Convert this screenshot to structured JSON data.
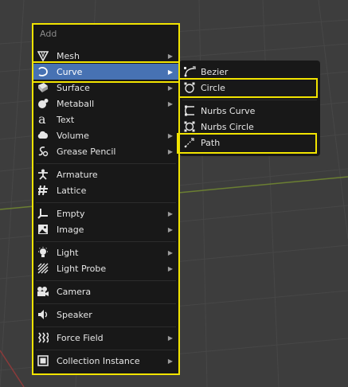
{
  "menu": {
    "title": "Add",
    "items": [
      {
        "label": "Mesh",
        "icon": "mesh-cone-icon",
        "arrow": "▶"
      },
      {
        "label": "Curve",
        "icon": "curve-icon",
        "arrow": "▶"
      },
      {
        "label": "Surface",
        "icon": "surface-icon",
        "arrow": "▶"
      },
      {
        "label": "Metaball",
        "icon": "metaball-icon",
        "arrow": "▶"
      },
      {
        "label": "Text",
        "icon": "text-icon"
      },
      {
        "label": "Volume",
        "icon": "volume-icon",
        "arrow": "▶"
      },
      {
        "label": "Grease Pencil",
        "icon": "grease-pencil-icon",
        "arrow": "▶"
      },
      {
        "label": "Armature",
        "icon": "armature-icon"
      },
      {
        "label": "Lattice",
        "icon": "lattice-icon"
      },
      {
        "label": "Empty",
        "icon": "empty-axis-icon",
        "arrow": "▶"
      },
      {
        "label": "Image",
        "icon": "image-icon",
        "arrow": "▶"
      },
      {
        "label": "Light",
        "icon": "light-bulb-icon",
        "arrow": "▶"
      },
      {
        "label": "Light Probe",
        "icon": "light-probe-icon",
        "arrow": "▶"
      },
      {
        "label": "Camera",
        "icon": "camera-icon"
      },
      {
        "label": "Speaker",
        "icon": "speaker-icon"
      },
      {
        "label": "Force Field",
        "icon": "force-field-icon",
        "arrow": "▶"
      },
      {
        "label": "Collection Instance",
        "icon": "collection-icon",
        "arrow": "▶"
      }
    ]
  },
  "submenu": {
    "items": [
      {
        "label": "Bezier",
        "icon": "bezier-icon"
      },
      {
        "label": "Circle",
        "icon": "bezier-circle-icon"
      },
      {
        "label": "Nurbs Curve",
        "icon": "nurbs-curve-icon"
      },
      {
        "label": "Nurbs Circle",
        "icon": "nurbs-circle-icon"
      },
      {
        "label": "Path",
        "icon": "path-icon"
      }
    ]
  },
  "colors": {
    "active": "#4772b3",
    "highlight": "#f2e400",
    "menu_bg": "#181818",
    "viewport_bg": "#3d3d3d"
  }
}
